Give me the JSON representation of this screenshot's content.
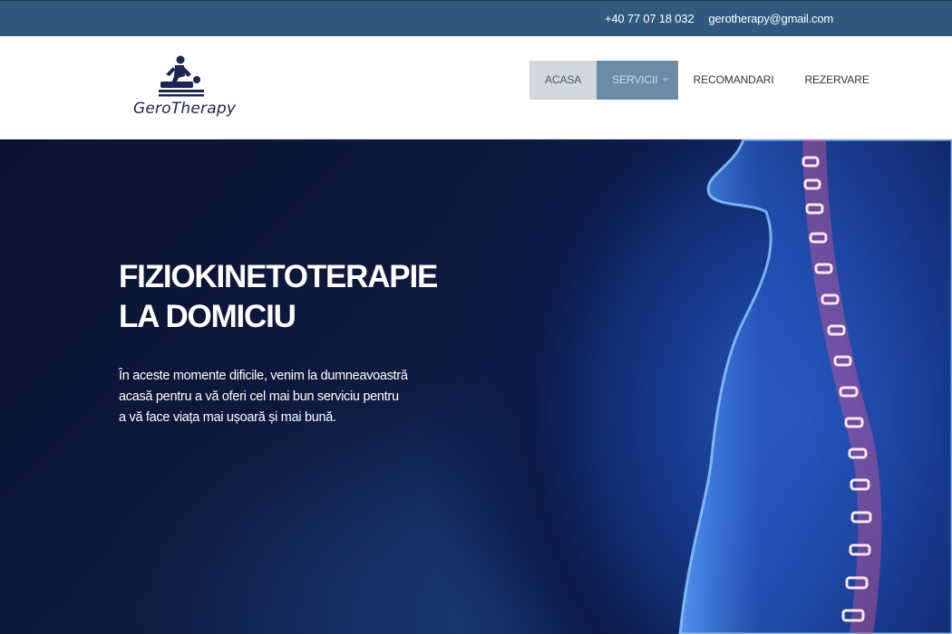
{
  "topbar": {
    "phone": "+40 77 07 18 032",
    "email": "gerotherapy@gmail.com"
  },
  "brand": {
    "name": "GeroTherapy",
    "logo_icon": "massage-therapy-icon",
    "color": "#1a2550"
  },
  "nav": {
    "items": [
      {
        "label": "ACASA"
      },
      {
        "label": "SERVICII"
      },
      {
        "label": "RECOMANDARI"
      },
      {
        "label": "REZERVARE"
      }
    ]
  },
  "hero": {
    "title_line1": "FIZIOKINETOTERAPIE",
    "title_line2": "LA DOMICIU",
    "text": "În aceste momente dificile, venim la dumneavoastră acasă pentru a vă oferi cel mai bun serviciu pentru a vă face viața mai ușoară și mai bună.",
    "image": "spine-xray-illustration"
  },
  "colors": {
    "topbar_bg": "#2f5a7e",
    "nav_active_bg": "#cfd8df",
    "nav_open_bg": "#6b8ba6",
    "hero_bg": "#0e1a3f"
  }
}
